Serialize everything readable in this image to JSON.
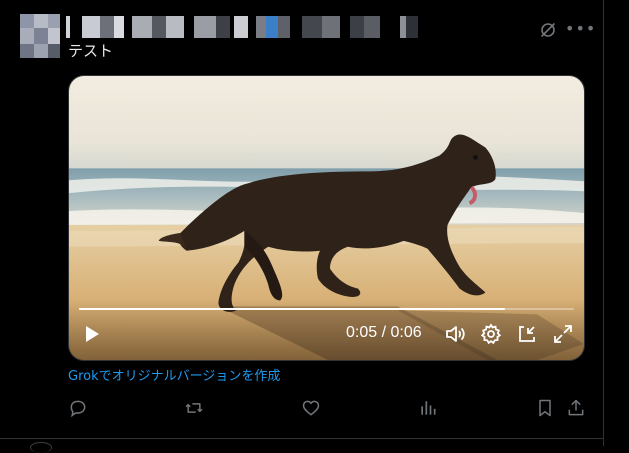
{
  "post": {
    "text": "テスト",
    "grok_link": "Grokでオリジナルバージョンを作成"
  },
  "video": {
    "time": "0:05 / 0:06",
    "progress": 0.86
  },
  "colors": {
    "background": "#000000",
    "text": "#e7e9ea",
    "muted": "#71767b",
    "link": "#1d9bf0",
    "border": "#2f3336"
  },
  "icons": {
    "more": "more-icon",
    "grok": "grok-icon",
    "play": "play-icon",
    "volume": "volume-icon",
    "settings": "gear-icon",
    "pip": "pip-icon",
    "fullscreen": "fullscreen-icon",
    "reply": "reply-icon",
    "repost": "repost-icon",
    "like": "heart-icon",
    "views": "views-icon",
    "bookmark": "bookmark-icon",
    "share": "share-icon"
  }
}
